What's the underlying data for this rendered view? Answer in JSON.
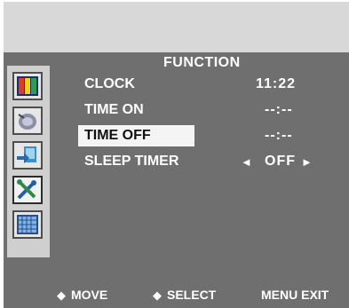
{
  "menu": {
    "title": "FUNCTION",
    "rows": [
      {
        "label": "CLOCK",
        "value": "11:22"
      },
      {
        "label": "TIME ON",
        "value": "--:--"
      },
      {
        "label": "TIME OFF",
        "value": "--:--"
      },
      {
        "label": "SLEEP TIMER",
        "value": "OFF"
      }
    ]
  },
  "sidebar": {
    "items": [
      {
        "icon": "color-bars-icon"
      },
      {
        "icon": "speaker-icon"
      },
      {
        "icon": "input-source-icon"
      },
      {
        "icon": "tools-icon",
        "selected": true
      },
      {
        "icon": "grid-screen-icon"
      }
    ]
  },
  "footer": {
    "move": "MOVE",
    "select": "SELECT",
    "menu_exit": "MENU EXIT",
    "bullet": "◆"
  },
  "arrows": {
    "left": "◄",
    "right": "►"
  },
  "colors": {
    "osd_background": "#6f6f6f",
    "top_band": "#d8d8d8",
    "highlight": "#f4f4f4",
    "text": "#ffffff"
  }
}
